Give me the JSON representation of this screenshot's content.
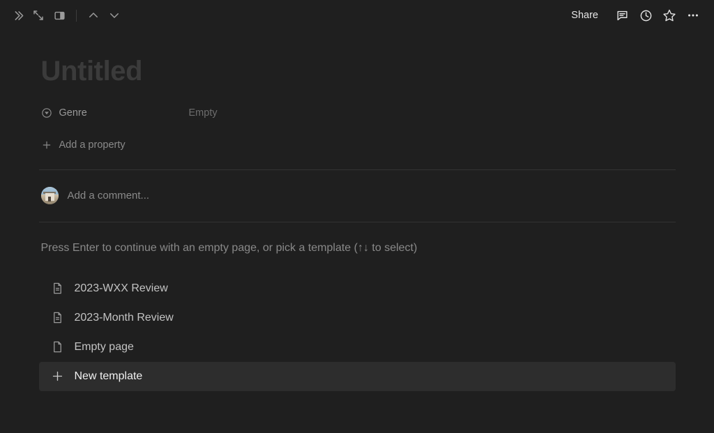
{
  "app": {
    "background_color": "#1f1f1f",
    "accent_selected_color": "#2d2d2d"
  },
  "topbar": {
    "left_icons": [
      {
        "name": "expand-sidebar-icon",
        "glyph": "chevrons-right"
      },
      {
        "name": "expand-page-icon",
        "glyph": "diagonal-arrows"
      },
      {
        "name": "page-layout-icon",
        "glyph": "panel"
      }
    ],
    "nav": {
      "prev_label": "chevron-up",
      "next_label": "chevron-down"
    },
    "share_label": "Share",
    "right_icons": [
      {
        "name": "comments-icon",
        "glyph": "speech-bubble"
      },
      {
        "name": "history-icon",
        "glyph": "clock"
      },
      {
        "name": "favorite-icon",
        "glyph": "star"
      },
      {
        "name": "more-options-icon",
        "glyph": "ellipsis"
      }
    ]
  },
  "page": {
    "title_placeholder": "Untitled",
    "properties": [
      {
        "icon": "select-property-icon",
        "label": "Genre",
        "value": "Empty"
      }
    ],
    "add_property_label": "Add a property",
    "comment": {
      "avatar_name": "user-avatar",
      "placeholder": "Add a comment..."
    },
    "template_picker": {
      "hint": "Press Enter to continue with an empty page, or pick a template (↑↓ to select)",
      "items": [
        {
          "icon": "document-lines-icon",
          "label": "2023-WXX Review",
          "selected": false
        },
        {
          "icon": "document-lines-icon",
          "label": "2023-Month Review",
          "selected": false
        },
        {
          "icon": "document-blank-icon",
          "label": "Empty page",
          "selected": false
        },
        {
          "icon": "plus-icon",
          "label": "New template",
          "selected": true
        }
      ]
    }
  }
}
